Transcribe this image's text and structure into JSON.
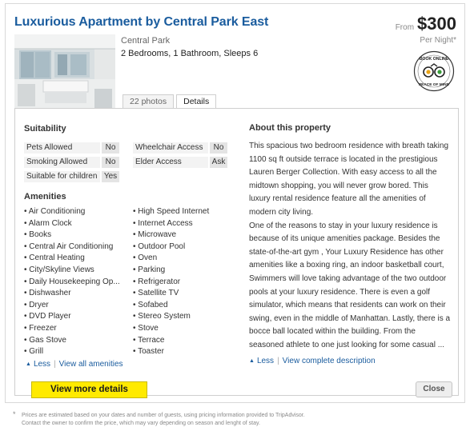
{
  "listing": {
    "title": "Luxurious Apartment by Central Park East",
    "location": "Central Park",
    "summary": "2 Bedrooms, 1 Bathroom, Sleeps 6",
    "price_from": "From",
    "price": "$300",
    "per_night": "Per Night*",
    "badge_text": "BOOK ONLINE PEACE OF MIND"
  },
  "tabs": [
    {
      "label": "22 photos"
    },
    {
      "label": "Details"
    }
  ],
  "suitability": {
    "heading": "Suitability",
    "rows": [
      {
        "label": "Pets Allowed",
        "value": "No"
      },
      {
        "label": "Smoking Allowed",
        "value": "No"
      },
      {
        "label": "Suitable for children",
        "value": "Yes"
      },
      {
        "label": "Wheelchair Access",
        "value": "No"
      },
      {
        "label": "Elder Access",
        "value": "Ask"
      }
    ]
  },
  "amenities": {
    "heading": "Amenities",
    "col1": [
      "Air Conditioning",
      "Alarm Clock",
      "Books",
      "Central Air Conditioning",
      "Central Heating",
      "City/Skyline Views",
      "Daily Housekeeping Op...",
      "Dishwasher",
      "Dryer",
      "DVD Player",
      "Freezer",
      "Gas Stove",
      "Grill"
    ],
    "col2": [
      "High Speed Internet",
      "Internet Access",
      "Microwave",
      "Outdoor Pool",
      "Oven",
      "Parking",
      "Refrigerator",
      "Satellite TV",
      "Sofabed",
      "Stereo System",
      "Stove",
      "Terrace",
      "Toaster"
    ],
    "less": "Less",
    "view_all": "View all amenities"
  },
  "about": {
    "heading": "About this property",
    "text": "This spacious two bedroom residence with breath taking 1100 sq ft outside terrace is located in the prestigious Lauren Berger Collection. With easy access to all the midtown shopping, you will never grow bored. This luxury rental residence feature all the amenities of modern city living.\nOne of the reasons to stay in your luxury residence is because of its unique amenities package. Besides the state-of-the-art gym , Your Luxury Residence has other amenities like a boxing ring, an indoor basketball court, Swimmers will love taking advantage of the two outdoor pools at your luxury residence. There is even a golf simulator, which means that residents can work on their swing, even in the middle of Manhattan. Lastly, there is a bocce ball located within the building. From the seasoned athlete to one just looking for some casual ...",
    "less": "Less",
    "view_complete": "View complete description"
  },
  "buttons": {
    "more_details": "View more details",
    "close": "Close"
  },
  "footnote": {
    "star": "*",
    "line1": "Prices are estimated based on your dates and number of guests, using pricing information provided to TripAdvisor.",
    "line2": "Contact the owner to confirm the price, which may vary depending on season and lenght of stay."
  },
  "colors": {
    "title_link": "#1a5c9e",
    "button_yellow": "#ffea00"
  }
}
